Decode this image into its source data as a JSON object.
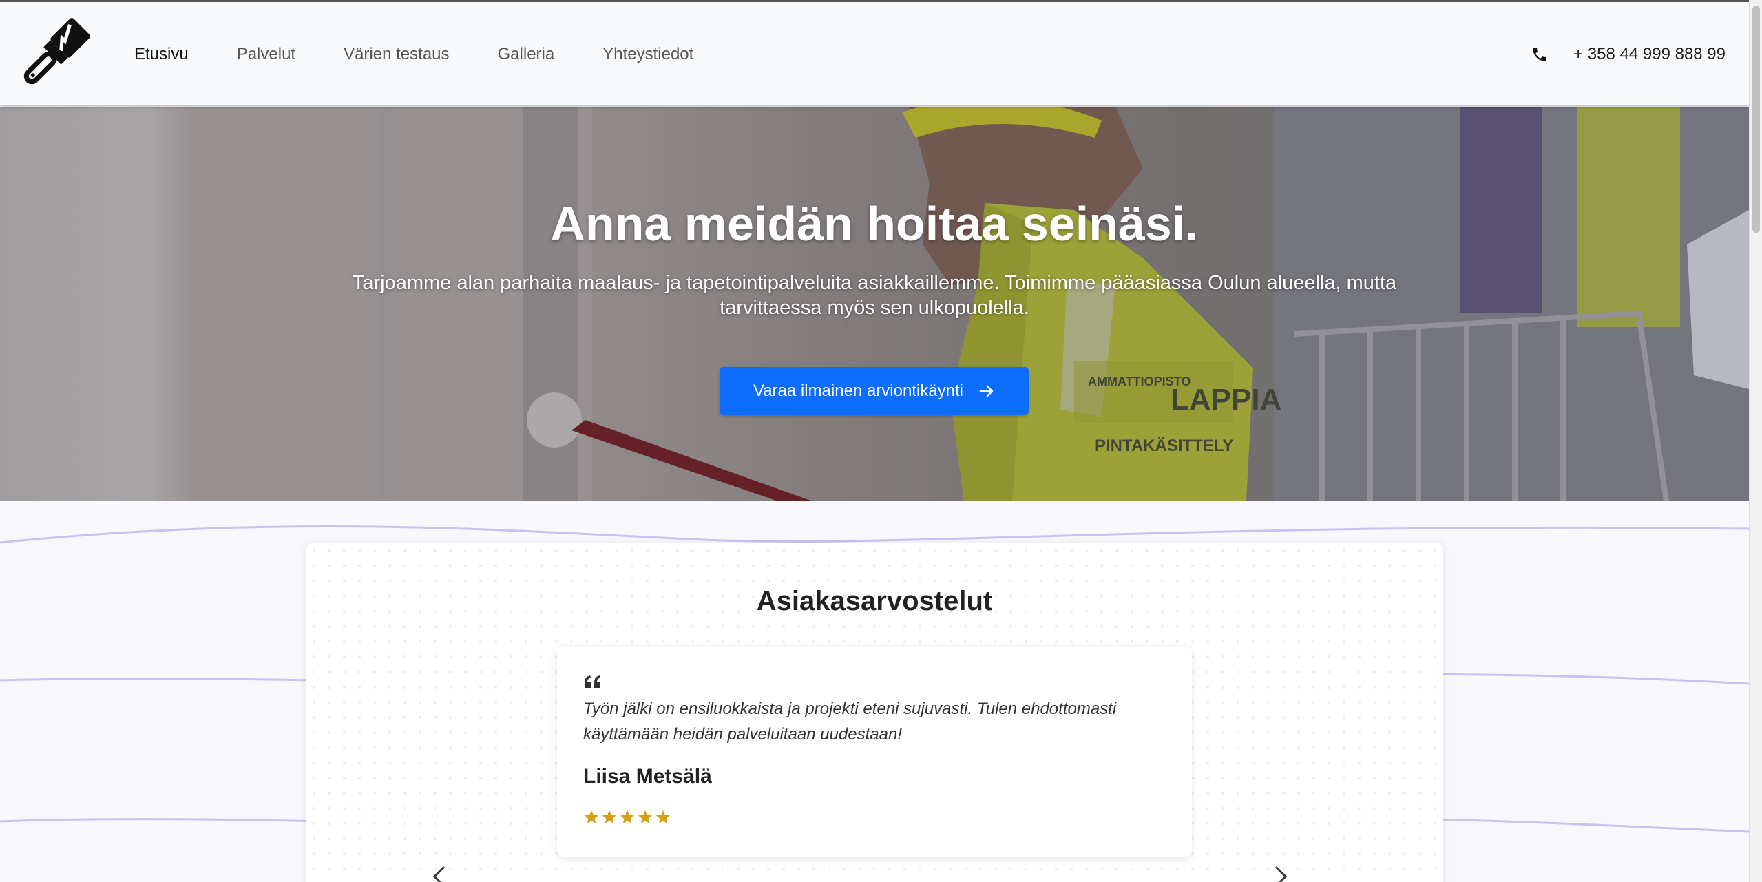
{
  "nav": {
    "items": [
      {
        "label": "Etusivu",
        "active": true
      },
      {
        "label": "Palvelut",
        "active": false
      },
      {
        "label": "Värien testaus",
        "active": false
      },
      {
        "label": "Galleria",
        "active": false
      },
      {
        "label": "Yhteystiedot",
        "active": false
      }
    ],
    "phone": "+ 358 44 999 888 99"
  },
  "hero": {
    "title": "Anna meidän hoitaa seinäsi.",
    "subtitle": "Tarjoamme alan parhaita maalaus- ja tapetointipalveluita asiakkaillemme. Toimimme pääasiassa Oulun alueella, mutta tarvittaessa myös sen ulkopuolella.",
    "button_label": "Varaa ilmainen arviontikäynti",
    "vest_text_1": "AMMATTIOPISTO",
    "vest_text_2": "LAPPIA",
    "vest_text_3": "PINTAKÄSITTELY"
  },
  "reviews": {
    "title": "Asiakasarvostelut",
    "items": [
      {
        "text": "Työn jälki on ensiluokkaista ja projekti eteni sujuvasti. Tulen ehdottomasti käyttämään heidän palveluitaan uudestaan!",
        "name": "Liisa Metsälä",
        "rating": 5
      }
    ]
  },
  "colors": {
    "accent": "#0d6efd",
    "star": "#d4a017",
    "wave": "#c7c3f0"
  },
  "icons": [
    "paintbrush-logo-icon",
    "phone-icon",
    "arrow-right-icon",
    "quote-icon",
    "star-icon",
    "chevron-left-icon",
    "chevron-right-icon"
  ]
}
